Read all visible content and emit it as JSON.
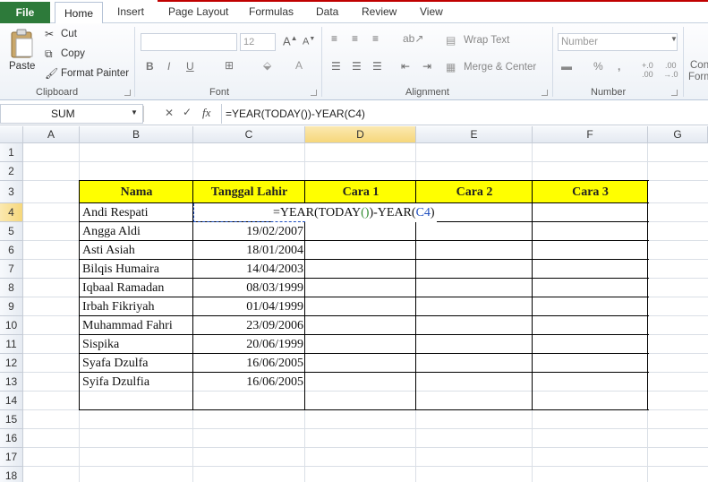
{
  "ribbon": {
    "tabs": [
      "File",
      "Home",
      "Insert",
      "Page Layout",
      "Formulas",
      "Data",
      "Review",
      "View"
    ],
    "clipboard": {
      "paste": "Paste",
      "cut": "Cut",
      "copy": "Copy",
      "format_painter": "Format Painter",
      "label": "Clipboard"
    },
    "font": {
      "size": "12",
      "bold": "B",
      "italic": "I",
      "underline": "U",
      "label": "Font"
    },
    "alignment": {
      "wrap_text": "Wrap Text",
      "merge_center": "Merge & Center",
      "label": "Alignment"
    },
    "number": {
      "format": "Number",
      "percent": "%",
      "comma": ",",
      "label": "Number"
    },
    "styles": {
      "cond1": "Con",
      "cond2": "Form"
    }
  },
  "formula_bar": {
    "name_box": "SUM",
    "fx": "fx",
    "formula": "=YEAR(TODAY())-YEAR(C4)"
  },
  "columns": [
    "A",
    "B",
    "C",
    "D",
    "E",
    "F",
    "G"
  ],
  "rows": [
    "1",
    "2",
    "3",
    "4",
    "5",
    "6",
    "7",
    "8",
    "9",
    "10",
    "11",
    "12",
    "13",
    "14",
    "15",
    "16",
    "17",
    "18"
  ],
  "table": {
    "headers": [
      "Nama",
      "Tanggal Lahir",
      "Cara 1",
      "Cara 2",
      "Cara 3"
    ],
    "editing_cell": {
      "p1": "=YEAR(TODAY",
      "p2": "()",
      "p3": ")-YEAR(",
      "p4": "C4",
      "p5": ")"
    },
    "rows": [
      {
        "nama": "Andi Respati",
        "tgl": ""
      },
      {
        "nama": "Angga Aldi",
        "tgl": "19/02/2007"
      },
      {
        "nama": "Asti Asiah",
        "tgl": "18/01/2004"
      },
      {
        "nama": "Bilqis Humaira",
        "tgl": "14/04/2003"
      },
      {
        "nama": "Iqbaal Ramadan",
        "tgl": "08/03/1999"
      },
      {
        "nama": "Irbah Fikriyah",
        "tgl": "01/04/1999"
      },
      {
        "nama": "Muhammad Fahri",
        "tgl": "23/09/2006"
      },
      {
        "nama": "Sispika",
        "tgl": "20/06/1999"
      },
      {
        "nama": "Syafa Dzulfa",
        "tgl": "16/06/2005"
      },
      {
        "nama": "Syifa Dzulfia",
        "tgl": "16/06/2005"
      }
    ]
  },
  "colors": {
    "file_tab": "#2d7a3a",
    "header_fill": "#ffff00",
    "paren_green": "#2e8b2e",
    "ref_blue": "#1f4fbf"
  }
}
